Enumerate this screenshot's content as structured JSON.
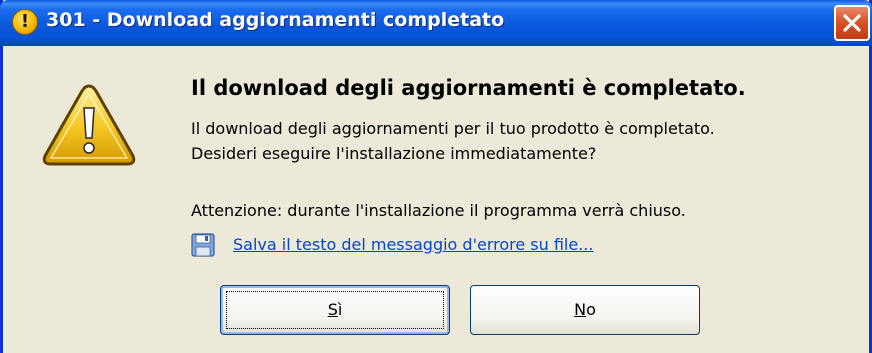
{
  "window": {
    "title": "301 - Download aggiornamenti completato",
    "title_icon": "!"
  },
  "dialog": {
    "heading": "Il download degli aggiornamenti è completato.",
    "message_line1": "Il download degli aggiornamenti per il tuo prodotto è completato.",
    "message_line2": "Desideri eseguire l'installazione immediatamente?",
    "warning": "Attenzione: durante l'installazione il programma verrà chiuso.",
    "save_link": "Salva il testo del messaggio d'errore su file..."
  },
  "buttons": {
    "yes_accel": "S",
    "yes_rest": "ì",
    "no_accel": "N",
    "no_rest": "o"
  },
  "icons": {
    "title": "exclamation-icon",
    "close": "close-icon",
    "main": "warning-triangle-icon",
    "save": "floppy-disk-icon"
  },
  "colors": {
    "titlebar": "#0a58dd",
    "close": "#d9542a",
    "dialog_bg": "#ece9d8",
    "link": "#0645c8"
  }
}
